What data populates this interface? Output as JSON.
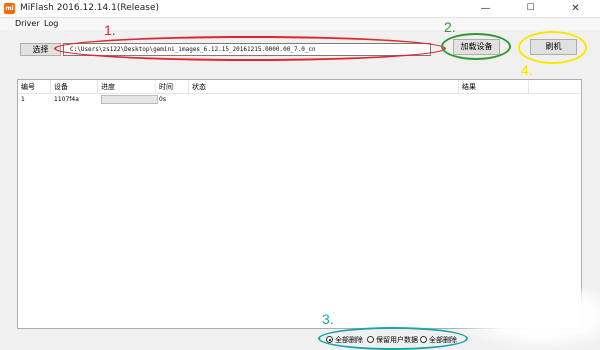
{
  "window": {
    "title": "MiFlash 2016.12.14.1(Release)",
    "icon_text": "mi",
    "minimize": "—",
    "maximize": "☐",
    "close": "✕"
  },
  "menu": [
    "Driver",
    "Log"
  ],
  "toolbar": {
    "select_label": "选择",
    "path_value": "C:\\Users\\zs122\\Desktop\\gemini_images_6.12.15_20161215.0000.00_7.0_cn",
    "load_device_label": "加载设备",
    "flash_label": "刷机"
  },
  "annotations": {
    "n1": "1.",
    "n2": "2.",
    "n3": "3.",
    "n4": "4.",
    "colors": {
      "red": "#e0252b",
      "green": "#2e9a2e",
      "yellow": "#ffe600",
      "teal": "#1aa6a6"
    }
  },
  "table": {
    "headers": [
      "编号",
      "设备",
      "进度",
      "时间",
      "状态",
      "结果"
    ],
    "rows": [
      {
        "num": "1",
        "device": "1107f4a",
        "progress": 0,
        "time": "0s",
        "status": "",
        "result": ""
      }
    ]
  },
  "options": {
    "selected": "全部删除",
    "items": [
      "全部删除",
      "保留用户数据",
      "全部删除"
    ]
  }
}
